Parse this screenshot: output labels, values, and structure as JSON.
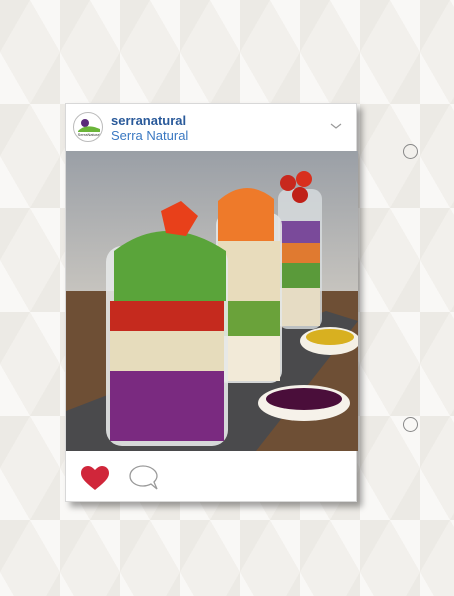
{
  "post": {
    "username": "serranatural",
    "display_name": "Serra Natural",
    "avatar_logo_text": "SerraNatural",
    "liked": true,
    "colors": {
      "like": "#d0263a",
      "username": "#2a5a9a",
      "display_name": "#3a78c2"
    }
  },
  "icons": [
    "chevron-down-icon",
    "heart-icon",
    "comment-icon",
    "circle-icon"
  ]
}
